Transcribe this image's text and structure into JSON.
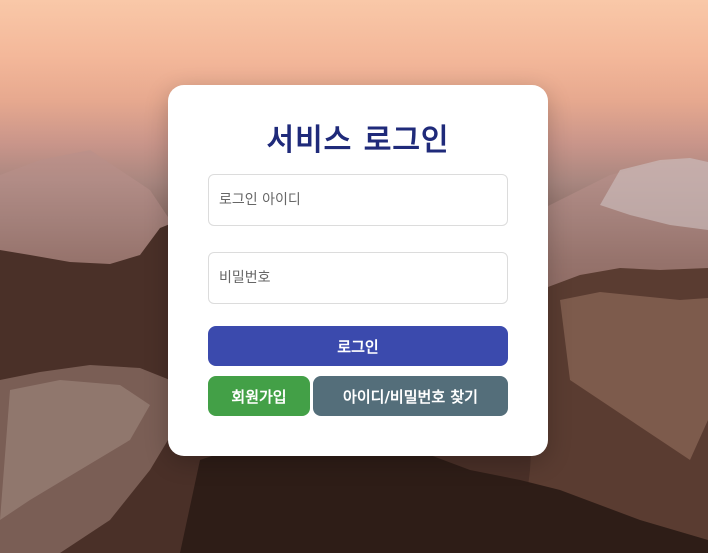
{
  "login": {
    "title": "서비스 로그인",
    "id_placeholder": "로그인 아이디",
    "password_placeholder": "비밀번호",
    "login_button": "로그인",
    "signup_button": "회원가입",
    "find_button": "아이디/비밀번호 찾기"
  },
  "colors": {
    "title": "#1f2a7a",
    "login_button": "#3b4aad",
    "signup_button": "#43a047",
    "find_button": "#546e7a"
  }
}
